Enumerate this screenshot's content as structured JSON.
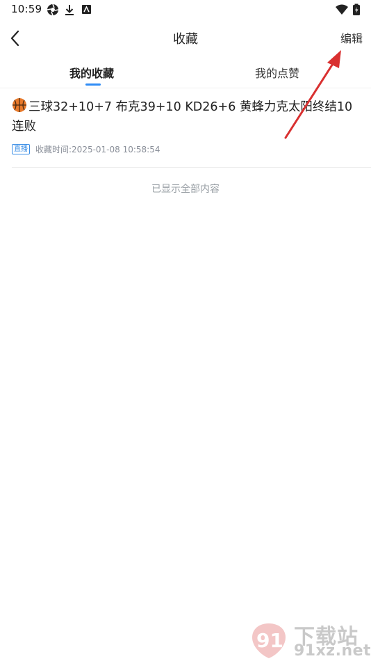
{
  "status_bar": {
    "time": "10:59"
  },
  "header": {
    "title": "收藏",
    "edit_label": "编辑"
  },
  "tabs": [
    {
      "label": "我的收藏",
      "active": true
    },
    {
      "label": "我的点赞",
      "active": false
    }
  ],
  "favorites": [
    {
      "title": "三球32+10+7 布克39+10 KD26+6 黄蜂力克太阳终结10连败",
      "badge": "直播",
      "collected_time": "收藏时间:2025-01-08 10:58:54"
    }
  ],
  "list_end_text": "已显示全部内容",
  "watermark": {
    "brand": "下载站",
    "domain": "91xz.net"
  },
  "colors": {
    "accent": "#2f8cf5",
    "annotation_arrow": "#d93030"
  }
}
